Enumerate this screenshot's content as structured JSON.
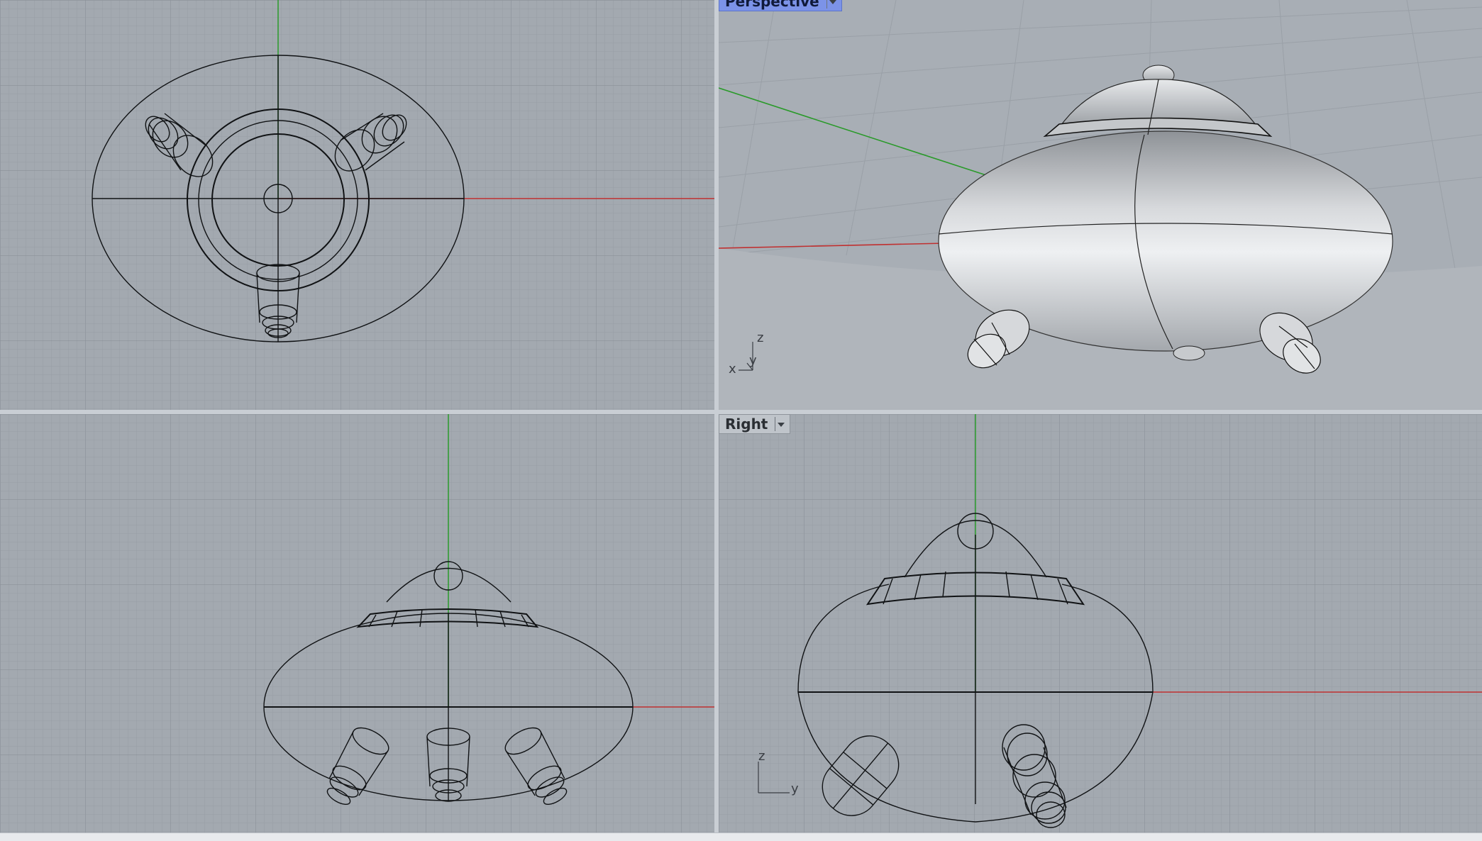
{
  "viewports": {
    "perspective": {
      "label": "Perspective"
    },
    "right": {
      "label": "Right"
    }
  },
  "axis_triad": {
    "z": "z",
    "y": "y",
    "x": "x"
  },
  "colors": {
    "viewport_bg": "#a3a9b0",
    "grid_minor": "#969ca4",
    "grid_major": "#888e96",
    "x_axis": "#c03030",
    "y_axis": "#2a9a2a",
    "active_label": "#7c93e8",
    "wire": "#101214"
  }
}
